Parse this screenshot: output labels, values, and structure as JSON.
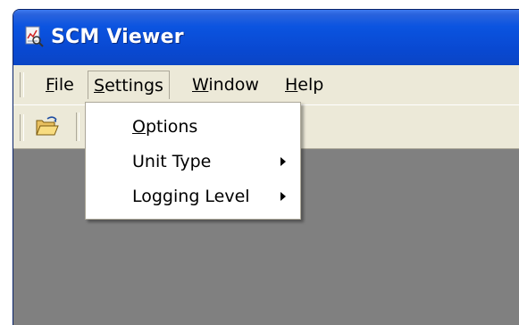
{
  "window": {
    "title": "SCM Viewer",
    "icon": "app-viewer-icon"
  },
  "menubar": {
    "items": [
      {
        "label": "File",
        "accel": "F",
        "rest": "ile"
      },
      {
        "label": "Settings",
        "accel": "S",
        "rest": "ettings"
      },
      {
        "label": "Window",
        "accel": "W",
        "rest": "indow"
      },
      {
        "label": "Help",
        "accel": "H",
        "rest": "elp"
      }
    ],
    "open_menu": "Settings"
  },
  "toolbar": {
    "buttons": [
      {
        "icon": "open-folder-icon"
      }
    ]
  },
  "settings_menu": {
    "items": [
      {
        "label": "Options",
        "accel": "O",
        "rest": "ptions",
        "submenu": false
      },
      {
        "label": "Unit Type",
        "submenu": true
      },
      {
        "label": "Logging Level",
        "submenu": true
      }
    ]
  },
  "colors": {
    "titlebar": "#0b54e0",
    "chrome": "#ece9d8",
    "client_area": "#808080",
    "menu_bg": "#ffffff"
  }
}
